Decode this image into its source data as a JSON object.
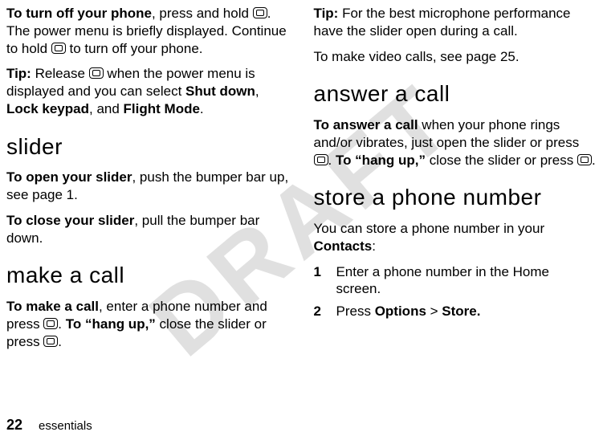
{
  "watermark": "DRAFT",
  "left": {
    "turn_off_1a": "To turn off your phone",
    "turn_off_1b": ", press and hold ",
    "turn_off_1c": ". The power menu is briefly displayed. Continue to hold ",
    "turn_off_1d": " to turn off your phone.",
    "tip_label": "Tip:",
    "tip_1a": " Release ",
    "tip_1b": " when the power menu is displayed and you can select ",
    "shut_down": "Shut down",
    "comma1": ", ",
    "lock_keypad": "Lock keypad",
    "and": ", and ",
    "flight_mode": "Flight Mode",
    "period": ".",
    "h_slider": "slider",
    "open_a": "To open your slider",
    "open_b": ", push the bumper bar up, see page 1.",
    "close_a": "To close your slider",
    "close_b": ", pull the bumper bar down.",
    "h_make": "make a call",
    "make_a": "To make a call",
    "make_b": ", enter a phone number and press ",
    "make_c": ". ",
    "hang_a": "To “hang up,”",
    "hang_b": " close the slider or press ",
    "hang_c": "."
  },
  "right": {
    "tip_label": "Tip:",
    "tip_text": " For the best microphone performance have the slider open during a call.",
    "video": "To make video calls, see page 25.",
    "h_answer": "answer a call",
    "ans_a": "To answer a call",
    "ans_b": " when your phone rings and/or vibrates, just open the slider or press ",
    "ans_c": ". ",
    "hang_a": "To “hang up,”",
    "hang_b": " close the slider or press ",
    "hang_c": ".",
    "h_store": "store a phone number",
    "store_a": "You can store a phone number in your ",
    "contacts": "Contacts",
    "store_b": ":",
    "step1_num": "1",
    "step1_txt": "Enter a phone number in the Home screen.",
    "step2_num": "2",
    "step2_a": "Press ",
    "options": "Options",
    "gt": " > ",
    "store": "Store."
  },
  "footer": {
    "page": "22",
    "section": "essentials"
  }
}
